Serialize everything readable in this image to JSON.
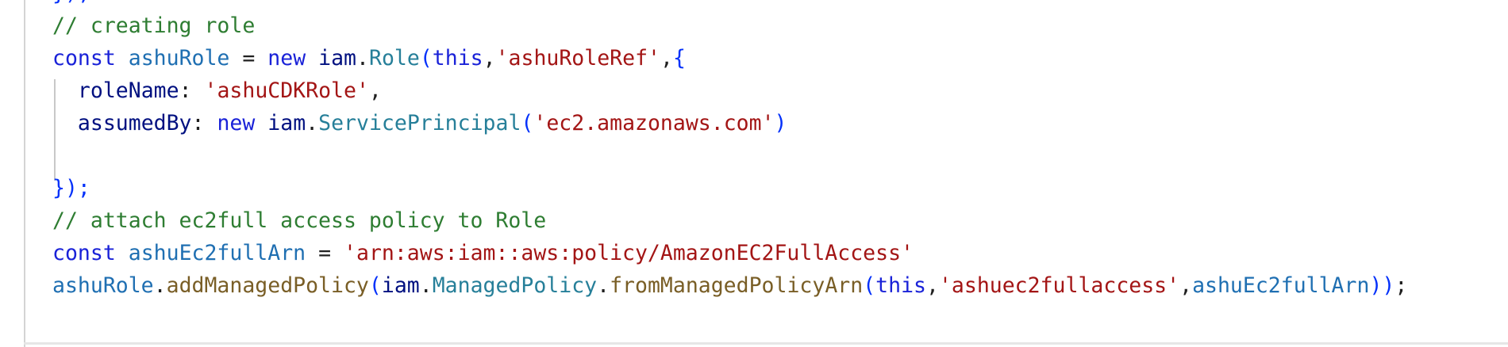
{
  "code": {
    "lines": [
      "});",
      "// creating role",
      "const ashuRole = new iam.Role(this,'ashuRoleRef',{",
      "  roleName: 'ashuCDKRole',",
      "  assumedBy: new iam.ServicePrincipal('ec2.amazonaws.com')",
      "",
      "});",
      "// attach ec2full access policy to Role",
      "const ashuEc2fullArn = 'arn:aws:iam::aws:policy/AmazonEC2FullAccess'",
      "ashuRole.addManagedPolicy(iam.ManagedPolicy.fromManagedPolicyArn(this,'ashuec2fullaccess',ashuEc2fullArn));"
    ]
  },
  "colors": {
    "comment": "#2e7d32",
    "keyword": "#1a22d8",
    "string": "#a31515",
    "type": "#267f99",
    "variable": "#1f6fb2",
    "identifier": "#001080",
    "function": "#795e26",
    "background": "#ffffff"
  }
}
